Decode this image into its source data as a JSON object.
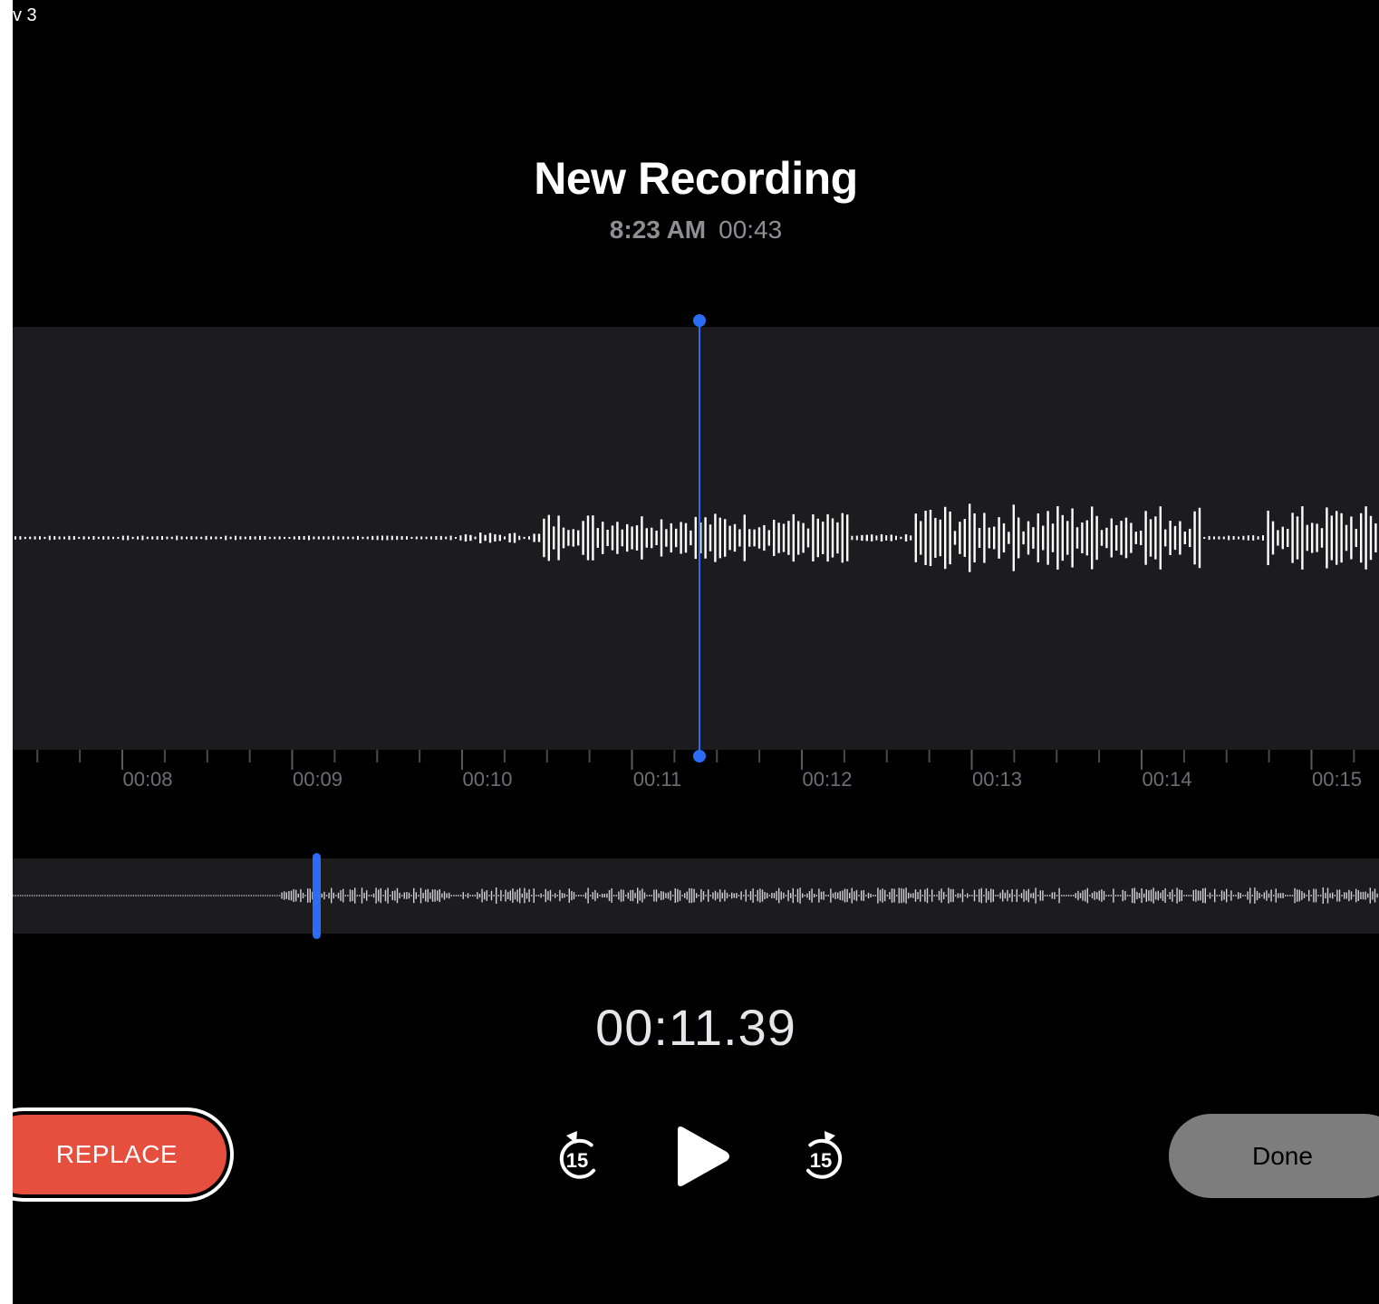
{
  "corner_text": "v 3",
  "recording": {
    "title": "New Recording",
    "date_time": "8:23 AM",
    "duration": "00:43"
  },
  "timeline": {
    "labels": [
      "00:08",
      "00:09",
      "00:10",
      "00:11",
      "00:12",
      "00:13",
      "00:14",
      "00:15"
    ]
  },
  "playback": {
    "current_time": "00:11.39",
    "skip_back_seconds": "15",
    "skip_forward_seconds": "15"
  },
  "buttons": {
    "replace_label": "REPLACE",
    "done_label": "Done"
  },
  "colors": {
    "accent": "#2a6df4",
    "replace": "#e64f3e",
    "done": "#7d7d7d",
    "wave_bg": "#1c1c1e"
  },
  "icons": {
    "skip_back": "skip-back-15-icon",
    "play": "play-icon",
    "skip_forward": "skip-forward-15-icon"
  }
}
